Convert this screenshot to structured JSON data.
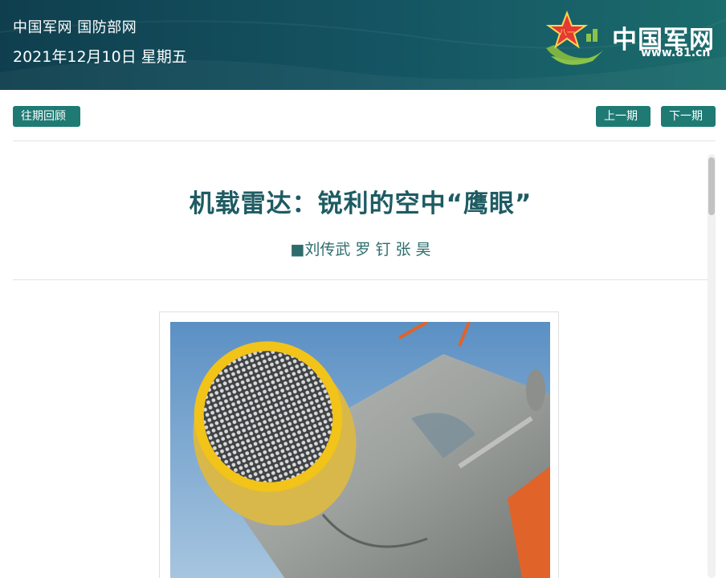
{
  "header": {
    "site_name": "中国军网 国防部网",
    "date": "2021年12月10日 星期五",
    "logo": {
      "name": "中国军网",
      "url": "www.81.cn",
      "emblem_text": "八一"
    },
    "colors": {
      "header_dark": "#0f3f4e",
      "header_light": "#1b6c6c",
      "button": "#1f7a74",
      "title": "#1e5b63"
    }
  },
  "toolbar": {
    "archive_label": "往期回顾",
    "prev_label": "上一期",
    "next_label": "下一期"
  },
  "article": {
    "title": "机载雷达：锐利的空中“鹰眼”",
    "author": "■刘传武 罗 钉 张 昊"
  },
  "figure": {
    "subject": "aircraft-radar-photo"
  }
}
